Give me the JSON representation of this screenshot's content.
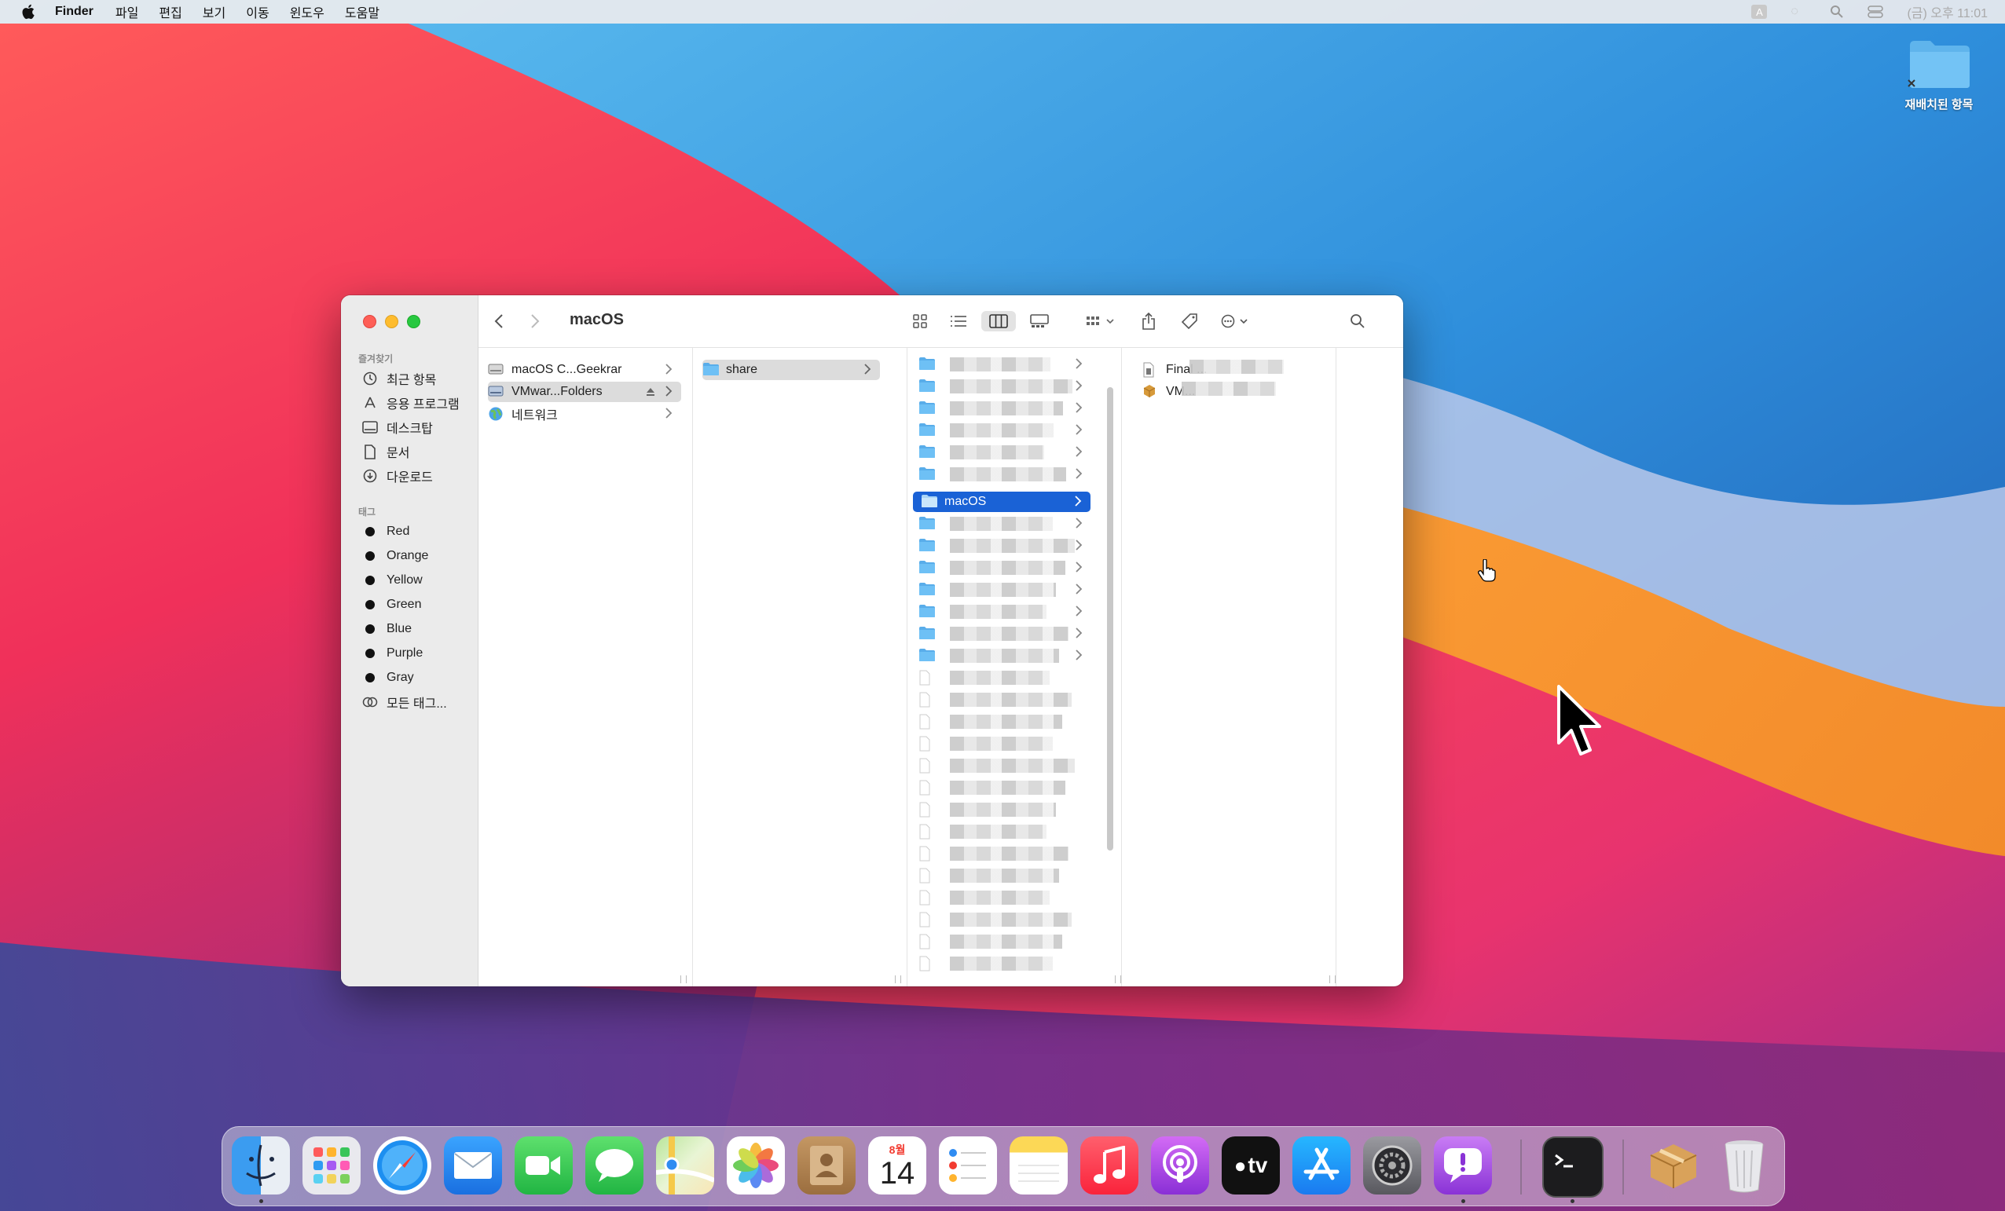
{
  "menubar": {
    "app": "Finder",
    "items": [
      "파일",
      "편집",
      "보기",
      "이동",
      "윈도우",
      "도움말"
    ],
    "clock": "(금) 오후 11:01"
  },
  "desktop": {
    "folder_label": "재배치된 항목"
  },
  "finder": {
    "title": "macOS",
    "sidebar": {
      "favorites_header": "즐겨찾기",
      "favorites": [
        {
          "label": "최근 항목",
          "icon": "clock-icon"
        },
        {
          "label": "응용 프로그램",
          "icon": "applications-icon"
        },
        {
          "label": "데스크탑",
          "icon": "desktop-icon"
        },
        {
          "label": "문서",
          "icon": "document-icon"
        },
        {
          "label": "다운로드",
          "icon": "download-icon"
        }
      ],
      "tags_header": "태그",
      "tags": [
        "Red",
        "Orange",
        "Yellow",
        "Green",
        "Blue",
        "Purple",
        "Gray"
      ],
      "all_tags": "모든 태그..."
    },
    "column1": [
      {
        "label": "macOS C...Geekrar",
        "selected": false
      },
      {
        "label": "VMwar...Folders",
        "selected": true
      },
      {
        "label": "네트워크",
        "selected": false
      }
    ],
    "column2": [
      {
        "label": "share",
        "selected": true
      }
    ],
    "column3_selected": "macOS",
    "column4": [
      "Final ...",
      "VM..."
    ]
  },
  "dock": {
    "apps": [
      {
        "name": "Finder",
        "running": true
      },
      {
        "name": "Launchpad",
        "running": false
      },
      {
        "name": "Safari",
        "running": false
      },
      {
        "name": "Mail",
        "running": false
      },
      {
        "name": "FaceTime",
        "running": false
      },
      {
        "name": "Messages",
        "running": false
      },
      {
        "name": "Maps",
        "running": false
      },
      {
        "name": "Photos",
        "running": false
      },
      {
        "name": "Contacts",
        "running": false
      },
      {
        "name": "Calendar",
        "running": false
      },
      {
        "name": "Reminders",
        "running": false
      },
      {
        "name": "Notes",
        "running": false
      },
      {
        "name": "Music",
        "running": false
      },
      {
        "name": "Podcasts",
        "running": false
      },
      {
        "name": "TV",
        "running": false
      },
      {
        "name": "App Store",
        "running": false
      },
      {
        "name": "System Preferences",
        "running": false
      },
      {
        "name": "Feedback Assistant",
        "running": true
      },
      {
        "name": "Terminal",
        "running": true
      },
      {
        "name": "Installer",
        "running": false
      },
      {
        "name": "Trash",
        "running": false
      }
    ],
    "calendar_month": "8월",
    "calendar_day": "14",
    "tv_label": "tv"
  }
}
